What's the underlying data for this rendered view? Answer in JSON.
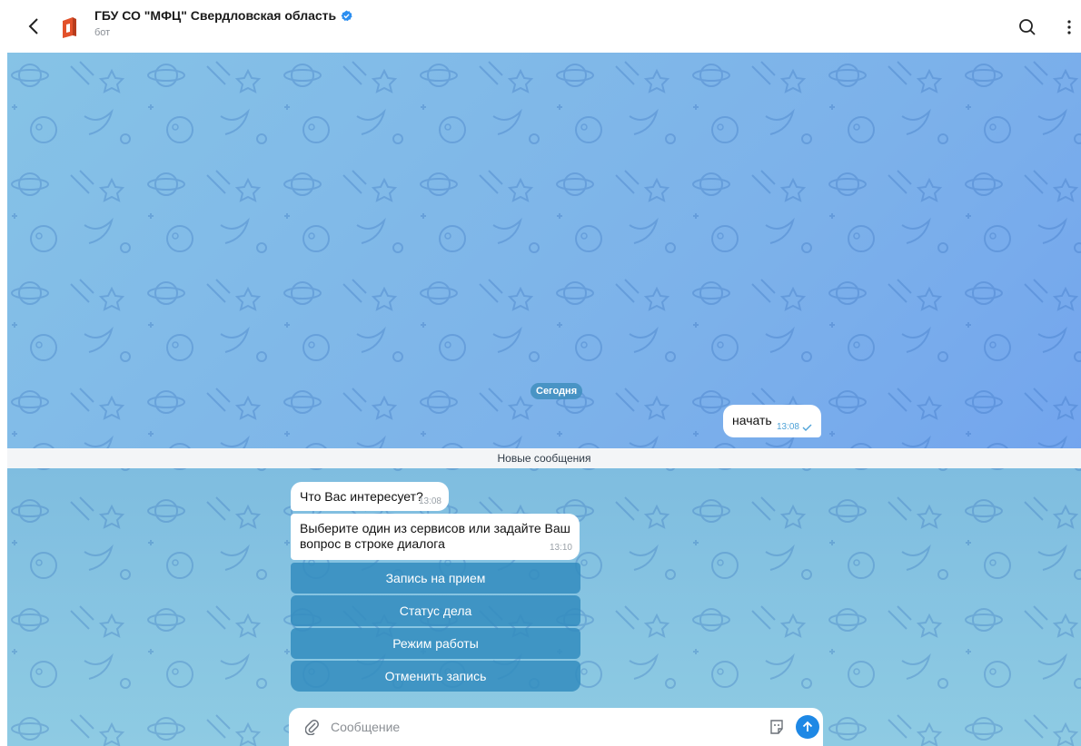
{
  "header": {
    "title": "ГБУ СО \"МФЦ\" Свердловская область",
    "subtitle": "бот"
  },
  "chat": {
    "date_label": "Сегодня",
    "outgoing": [
      {
        "text": "начать",
        "time": "13:08"
      }
    ],
    "new_messages_label": "Новые сообщения",
    "incoming": [
      {
        "text": "Что Вас интересует?",
        "time": "13:08"
      },
      {
        "text": "Выберите один из сервисов или задайте Ваш вопрос в строке диалога",
        "time": "13:10"
      }
    ],
    "keyboard": [
      {
        "label": "Запись на прием"
      },
      {
        "label": "Статус дела"
      },
      {
        "label": "Режим работы"
      },
      {
        "label": "Отменить запись"
      }
    ]
  },
  "composer": {
    "placeholder": "Сообщение",
    "value": ""
  },
  "colors": {
    "accent": "#1e88e5",
    "keyboard_button": "#328cbe",
    "verified": "#2b8ef0",
    "brand": "#e2512a"
  }
}
